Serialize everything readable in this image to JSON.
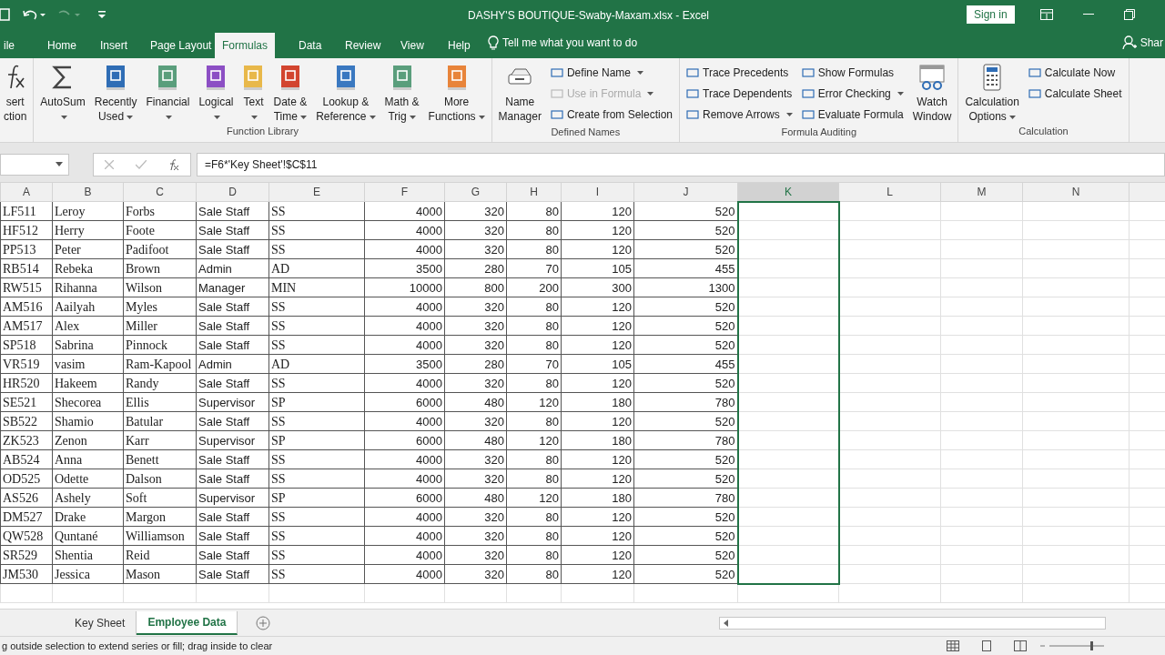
{
  "title_bar": {
    "title": "DASHY'S BOUTIQUE-Swaby-Maxam.xlsx  -  Excel",
    "sign_in": "Sign in"
  },
  "menu_tabs": [
    {
      "label": "ile",
      "selected": false
    },
    {
      "label": "Home",
      "selected": false
    },
    {
      "label": "Insert",
      "selected": false
    },
    {
      "label": "Page Layout",
      "selected": false
    },
    {
      "label": "Formulas",
      "selected": true
    },
    {
      "label": "Data",
      "selected": false
    },
    {
      "label": "Review",
      "selected": false
    },
    {
      "label": "View",
      "selected": false
    },
    {
      "label": "Help",
      "selected": false
    }
  ],
  "tell_me": "Tell me what you want to do",
  "share": "Shar",
  "ribbon": {
    "groups": [
      {
        "large": [
          {
            "kind": "function",
            "lines": [
              "sert",
              "ction"
            ],
            "dropdown": false
          }
        ]
      },
      {
        "label": "Function Library",
        "large": [
          {
            "kind": "sigma",
            "lines": [
              "AutoSum"
            ],
            "dropdown": true
          },
          {
            "kind": "book",
            "color": "#2f6db5",
            "lines": [
              "Recently",
              "Used"
            ],
            "dropdown": true
          },
          {
            "kind": "book",
            "color": "#5a9e7c",
            "lines": [
              "Financial"
            ],
            "dropdown": true
          },
          {
            "kind": "book",
            "color": "#8c4fc4",
            "lines": [
              "Logical"
            ],
            "dropdown": true
          },
          {
            "kind": "book",
            "color": "#e8b84a",
            "lines": [
              "Text"
            ],
            "dropdown": true
          },
          {
            "kind": "book",
            "color": "#d2452f",
            "lines": [
              "Date &",
              "Time"
            ],
            "dropdown": true
          },
          {
            "kind": "book",
            "color": "#3a78c0",
            "lines": [
              "Lookup &",
              "Reference"
            ],
            "dropdown": true
          },
          {
            "kind": "book",
            "color": "#5a9e7c",
            "lines": [
              "Math &",
              "Trig"
            ],
            "dropdown": true
          },
          {
            "kind": "book",
            "color": "#e8843a",
            "lines": [
              "More",
              "Functions"
            ],
            "dropdown": true
          }
        ]
      },
      {
        "label": "Defined Names",
        "large": [
          {
            "kind": "names",
            "lines": [
              "Name",
              "Manager"
            ],
            "dropdown": false
          }
        ],
        "small": [
          [
            {
              "label": "Define Name",
              "dropdown": true,
              "disabled": false
            },
            {
              "label": "Use in Formula",
              "dropdown": true,
              "disabled": true
            },
            {
              "label": "Create from Selection",
              "dropdown": false,
              "disabled": false
            }
          ]
        ]
      },
      {
        "label": "Formula Auditing",
        "small": [
          [
            {
              "label": "Trace Precedents",
              "dropdown": false,
              "disabled": false
            },
            {
              "label": "Trace Dependents",
              "dropdown": false,
              "disabled": false
            },
            {
              "label": "Remove Arrows",
              "dropdown": true,
              "disabled": false
            }
          ],
          [
            {
              "label": "Show Formulas",
              "dropdown": false,
              "disabled": false
            },
            {
              "label": "Error Checking",
              "dropdown": true,
              "disabled": false
            },
            {
              "label": "Evaluate Formula",
              "dropdown": false,
              "disabled": false
            }
          ]
        ],
        "large_after": [
          {
            "kind": "watch",
            "lines": [
              "Watch",
              "Window"
            ],
            "dropdown": false
          }
        ]
      },
      {
        "label": "Calculation",
        "large": [
          {
            "kind": "calculator",
            "lines": [
              "Calculation",
              "Options"
            ],
            "dropdown": true
          }
        ],
        "small": [
          [
            {
              "label": "Calculate Now",
              "dropdown": false,
              "disabled": false
            },
            {
              "label": "Calculate Sheet",
              "dropdown": false,
              "disabled": false
            }
          ]
        ]
      }
    ]
  },
  "formula_bar": {
    "formula": "=F6*'Key Sheet'!$C$11"
  },
  "table": {
    "columns": [
      {
        "label": "A",
        "selected": false
      },
      {
        "label": "B",
        "selected": false
      },
      {
        "label": "C",
        "selected": false
      },
      {
        "label": "D",
        "selected": false
      },
      {
        "label": "E",
        "selected": false
      },
      {
        "label": "F",
        "selected": false
      },
      {
        "label": "G",
        "selected": false
      },
      {
        "label": "H",
        "selected": false
      },
      {
        "label": "I",
        "selected": false
      },
      {
        "label": "J",
        "selected": false
      },
      {
        "label": "K",
        "selected": true
      },
      {
        "label": "L",
        "selected": false
      },
      {
        "label": "M",
        "selected": false
      },
      {
        "label": "N",
        "selected": false
      }
    ],
    "rows": [
      [
        "LF511",
        "Leroy",
        "Forbs",
        "Sale Staff",
        "SS",
        "4000",
        "320",
        "80",
        "120",
        "520"
      ],
      [
        "HF512",
        "Herry",
        "Foote",
        "Sale Staff",
        "SS",
        "4000",
        "320",
        "80",
        "120",
        "520"
      ],
      [
        "PP513",
        "Peter",
        "Padifoot",
        "Sale Staff",
        "SS",
        "4000",
        "320",
        "80",
        "120",
        "520"
      ],
      [
        "RB514",
        "Rebeka",
        "Brown",
        "Admin",
        "AD",
        "3500",
        "280",
        "70",
        "105",
        "455"
      ],
      [
        "RW515",
        "Rihanna",
        "Wilson",
        "Manager",
        "MIN",
        "10000",
        "800",
        "200",
        "300",
        "1300"
      ],
      [
        "AM516",
        "Aailyah",
        "Myles",
        "Sale Staff",
        "SS",
        "4000",
        "320",
        "80",
        "120",
        "520"
      ],
      [
        "AM517",
        "Alex",
        "Miller",
        "Sale Staff",
        "SS",
        "4000",
        "320",
        "80",
        "120",
        "520"
      ],
      [
        "SP518",
        "Sabrina",
        "Pinnock",
        "Sale Staff",
        "SS",
        "4000",
        "320",
        "80",
        "120",
        "520"
      ],
      [
        "VR519",
        "vasim",
        "Ram-Kapool",
        "Admin",
        "AD",
        "3500",
        "280",
        "70",
        "105",
        "455"
      ],
      [
        "HR520",
        "Hakeem",
        "Randy",
        "Sale Staff",
        "SS",
        "4000",
        "320",
        "80",
        "120",
        "520"
      ],
      [
        "SE521",
        "Shecorea",
        "Ellis",
        "Supervisor",
        "SP",
        "6000",
        "480",
        "120",
        "180",
        "780"
      ],
      [
        "SB522",
        "Shamio",
        "Batular",
        "Sale Staff",
        "SS",
        "4000",
        "320",
        "80",
        "120",
        "520"
      ],
      [
        "ZK523",
        "Zenon",
        "Karr",
        "Supervisor",
        "SP",
        "6000",
        "480",
        "120",
        "180",
        "780"
      ],
      [
        "AB524",
        "Anna",
        "Benett",
        "Sale Staff",
        "SS",
        "4000",
        "320",
        "80",
        "120",
        "520"
      ],
      [
        "OD525",
        "Odette",
        "Dalson",
        "Sale Staff",
        "SS",
        "4000",
        "320",
        "80",
        "120",
        "520"
      ],
      [
        "AS526",
        "Ashely",
        "Soft",
        "Supervisor",
        "SP",
        "6000",
        "480",
        "120",
        "180",
        "780"
      ],
      [
        "DM527",
        "Drake",
        "Margon",
        "Sale Staff",
        "SS",
        "4000",
        "320",
        "80",
        "120",
        "520"
      ],
      [
        "QW528",
        "Quntané",
        "Williamson",
        "Sale Staff",
        "SS",
        "4000",
        "320",
        "80",
        "120",
        "520"
      ],
      [
        "SR529",
        "Shentia",
        "Reid",
        "Sale Staff",
        "SS",
        "4000",
        "320",
        "80",
        "120",
        "520"
      ],
      [
        "JM530",
        "Jessica",
        "Mason",
        "Sale Staff",
        "SS",
        "4000",
        "320",
        "80",
        "120",
        "520"
      ]
    ]
  },
  "sheet_tabs": [
    {
      "label": "Key Sheet",
      "selected": false
    },
    {
      "label": "Employee Data",
      "selected": true
    }
  ],
  "status_bar": {
    "message": "g outside selection to extend series or fill; drag inside to clear"
  }
}
